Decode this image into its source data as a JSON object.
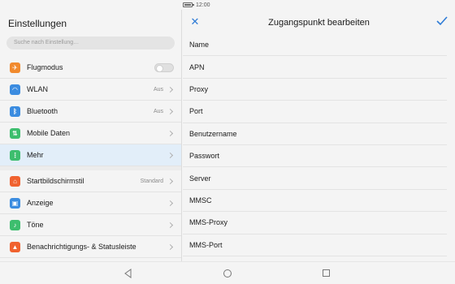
{
  "status": {
    "time": "12:00"
  },
  "left": {
    "title": "Einstellungen",
    "search_placeholder": "Suche nach Einstellung…",
    "items": [
      {
        "label": "Flugmodus",
        "icon": "airplane-icon",
        "color": "#f18a2d",
        "control": "toggle"
      },
      {
        "label": "WLAN",
        "icon": "wifi-icon",
        "color": "#3b8ce0",
        "value": "Aus"
      },
      {
        "label": "Bluetooth",
        "icon": "bluetooth-icon",
        "color": "#3b8ce0",
        "value": "Aus"
      },
      {
        "label": "Mobile Daten",
        "icon": "mobile-data-icon",
        "color": "#3dbe6e"
      },
      {
        "label": "Mehr",
        "icon": "more-icon",
        "color": "#3dbe6e",
        "active": true
      },
      {
        "label": "Startbildschirmstil",
        "icon": "home-icon",
        "color": "#f0622f",
        "value": "Standard"
      },
      {
        "label": "Anzeige",
        "icon": "display-icon",
        "color": "#3b8ce0"
      },
      {
        "label": "Töne",
        "icon": "sound-icon",
        "color": "#3dbe6e"
      },
      {
        "label": "Benachrichtigungs- & Statusleiste",
        "icon": "notification-icon",
        "color": "#f0622f"
      }
    ]
  },
  "right": {
    "title": "Zugangspunkt bearbeiten",
    "fields": [
      "Name",
      "APN",
      "Proxy",
      "Port",
      "Benutzername",
      "Passwort",
      "Server",
      "MMSC",
      "MMS-Proxy",
      "MMS-Port"
    ]
  },
  "colors": {
    "accent": "#2f7cd6"
  }
}
